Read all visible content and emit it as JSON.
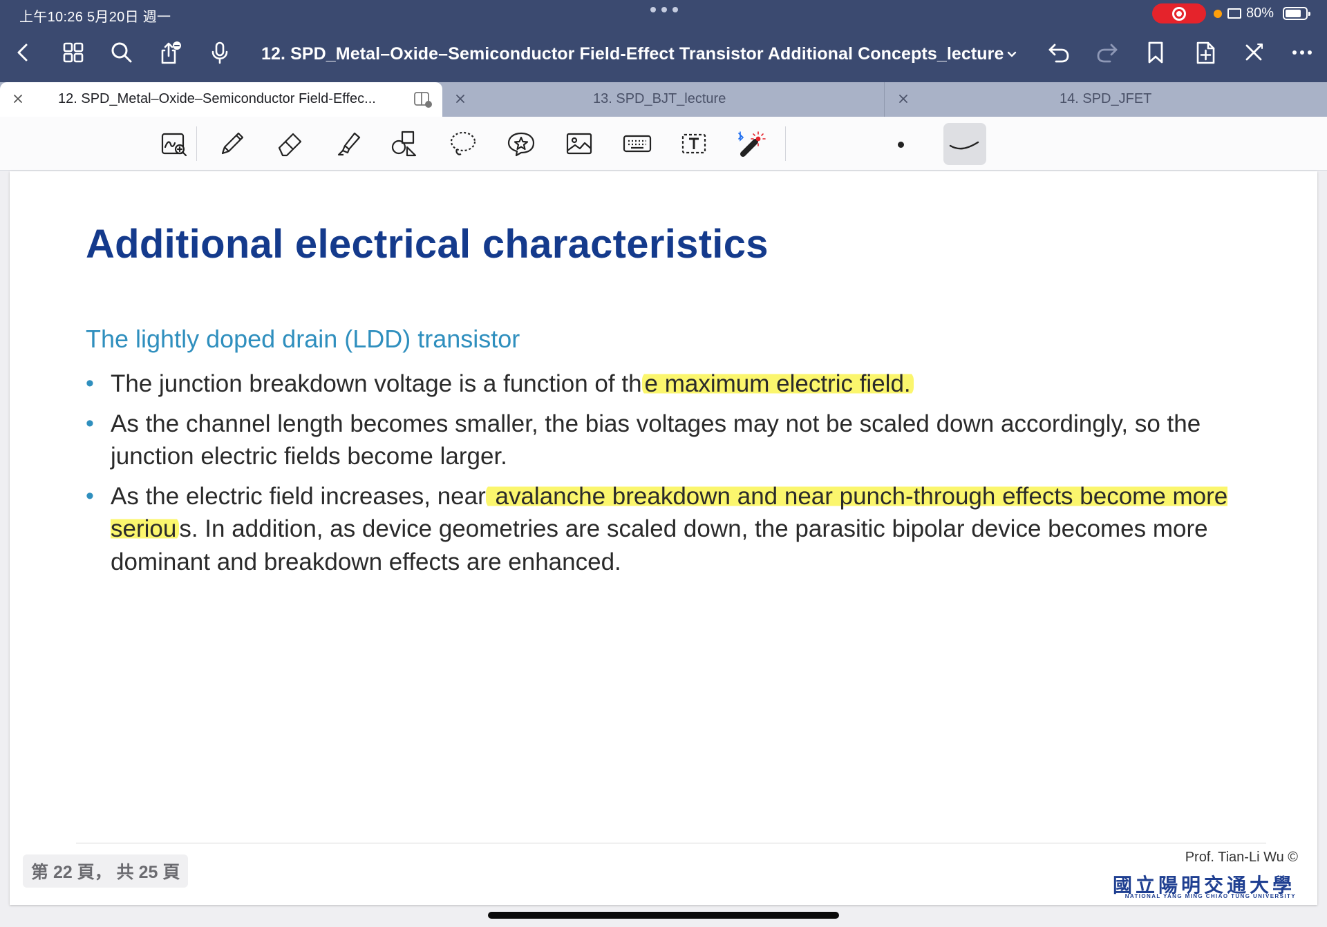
{
  "status_bar": {
    "time": "上午10:26   5月20日 週一",
    "battery": "80%",
    "battery_level": 0.8
  },
  "nav": {
    "title": "12. SPD_Metal–Oxide–Semiconductor Field-Effect Transistor Additional Concepts_lecture",
    "icons": [
      "back-chevron-icon",
      "grid-icon",
      "search-icon",
      "share-icon",
      "microphone-icon",
      "undo-icon",
      "redo-icon",
      "bookmark-icon",
      "add-page-icon",
      "close-icon",
      "more-icon"
    ]
  },
  "tabs": [
    {
      "label": "12. SPD_Metal–Oxide–Semiconductor Field-Effec...",
      "active": true
    },
    {
      "label": "13. SPD_BJT_lecture",
      "active": false
    },
    {
      "label": "14. SPD_JFET",
      "active": false
    }
  ],
  "toolbar": {
    "tools": [
      "zoom-write-icon",
      "pen-icon",
      "eraser-icon",
      "highlighter-icon",
      "shapes-icon",
      "lasso-icon",
      "sticker-icon",
      "image-icon",
      "keyboard-icon",
      "text-box-icon",
      "laser-pointer-icon"
    ]
  },
  "slide": {
    "title": "Additional electrical characteristics",
    "subtitle": "The lightly doped drain (LDD) transistor",
    "bullets": [
      {
        "before": "The junction breakdown voltage is a function of th",
        "highlight": "e maximum electric field.",
        "after": ""
      },
      {
        "before": "As the channel length becomes smaller, the bias voltages may not be scaled down accordingly, so the junction electric fields become larger.",
        "highlight": "",
        "after": ""
      },
      {
        "before": "As the electric field increases, near",
        "highlight": " avalanche breakdown and near punch-through effects become more seriou",
        "after": "s. In addition, as device geometries are scaled down, the parasitic bipolar device becomes more dominant and breakdown effects are enhanced."
      }
    ],
    "page_indicator": "第 22 頁，  共 25 頁",
    "author": "Prof. Tian-Li Wu ©",
    "university_zh": "國立陽明交通大學",
    "university_en": "NATIONAL YANG MING CHIAO TUNG UNIVERSITY"
  },
  "colors": {
    "chrome": "#3b4a70",
    "title": "#143a8c",
    "subtitle": "#2f8fbe",
    "highlight": "#fbf66d",
    "record": "#e5232b"
  }
}
